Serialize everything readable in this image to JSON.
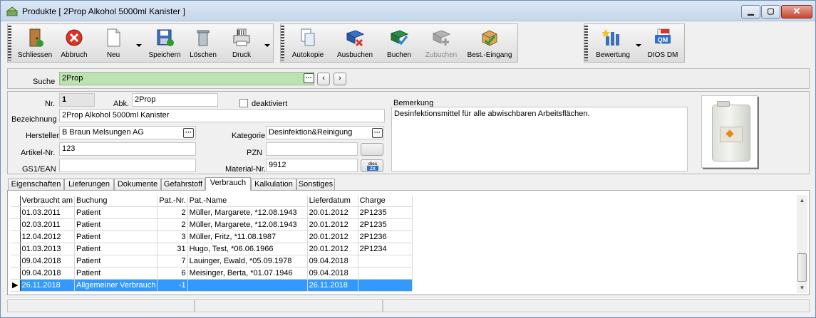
{
  "window": {
    "title": "Produkte [ 2Prop Alkohol 5000ml Kanister ]"
  },
  "toolbar": {
    "schliessen": "Schliessen",
    "abbruch": "Abbruch",
    "neu": "Neu",
    "speichern": "Speichern",
    "loeschen": "Löschen",
    "druck": "Druck",
    "autokopie": "Autokopie",
    "ausbuchen": "Ausbuchen",
    "buchen": "Buchen",
    "zubuchen": "Zubuchen",
    "best_eingang": "Best.-Eingang",
    "bewertung": "Bewertung",
    "dios_dm": "DIOS DM"
  },
  "search": {
    "label": "Suche",
    "value": "2Prop"
  },
  "form": {
    "nr_label": "Nr.",
    "nr_value": "1",
    "abk_label": "Abk.",
    "abk_value": "2Prop",
    "deaktiviert_label": "deaktiviert",
    "bezeichnung_label": "Bezeichnung",
    "bezeichnung_value": "2Prop Alkohol 5000ml Kanister",
    "hersteller_label": "Hersteller",
    "hersteller_value": "B Braun Melsungen AG",
    "kategorie_label": "Kategorie",
    "kategorie_value": "Desinfektion&Reinigung",
    "artikelnr_label": "Artikel-Nr.",
    "artikelnr_value": "123",
    "pzn_label": "PZN",
    "pzn_value": "",
    "gs1_label": "GS1/EAN",
    "gs1_value": "",
    "materialnr_label": "Material-Nr.",
    "materialnr_value": "9912",
    "bemerkung_label": "Bemerkung",
    "bemerkung_value": "Desinfektionsmittel für alle abwischbaren Arbeitsflächen.",
    "dios_zx_label": "dios ZX"
  },
  "tabs": [
    "Eigenschaften",
    "Lieferungen",
    "Dokumente",
    "Gefahrstoff",
    "Verbrauch",
    "Kalkulation",
    "Sonstiges"
  ],
  "table": {
    "headers": {
      "verbraucht_am": "Verbraucht am",
      "buchung": "Buchung",
      "patnr": "Pat.-Nr.",
      "patname": "Pat.-Name",
      "lieferdatum": "Lieferdatum",
      "charge": "Charge"
    },
    "rows": [
      {
        "date": "01.03.2011",
        "buchung": "Patient",
        "patnr": "2",
        "patname": "Müller, Margarete, *12.08.1943",
        "lieferdatum": "20.01.2012",
        "charge": "2P1235"
      },
      {
        "date": "02.03.2011",
        "buchung": "Patient",
        "patnr": "2",
        "patname": "Müller, Margarete, *12.08.1943",
        "lieferdatum": "20.01.2012",
        "charge": "2P1235"
      },
      {
        "date": "12.04.2012",
        "buchung": "Patient",
        "patnr": "3",
        "patname": "Müller, Fritz, *11.08.1987",
        "lieferdatum": "20.01.2012",
        "charge": "2P1236"
      },
      {
        "date": "01.03.2013",
        "buchung": "Patient",
        "patnr": "31",
        "patname": "Hugo, Test, *06.06.1966",
        "lieferdatum": "20.01.2012",
        "charge": "2P1234"
      },
      {
        "date": "09.04.2018",
        "buchung": "Patient",
        "patnr": "7",
        "patname": "Lauinger, Ewald, *05.09.1978",
        "lieferdatum": "09.04.2018",
        "charge": ""
      },
      {
        "date": "09.04.2018",
        "buchung": "Patient",
        "patnr": "6",
        "patname": "Meisinger, Berta, *01.07.1946",
        "lieferdatum": "09.04.2018",
        "charge": ""
      },
      {
        "date": "26.11.2018",
        "buchung": "Allgemeiner Verbrauch",
        "patnr": "-1",
        "patname": "",
        "lieferdatum": "26.11.2018",
        "charge": ""
      }
    ]
  },
  "colors": {
    "selection": "#3399ff",
    "search_bg": "#bde1b2"
  }
}
